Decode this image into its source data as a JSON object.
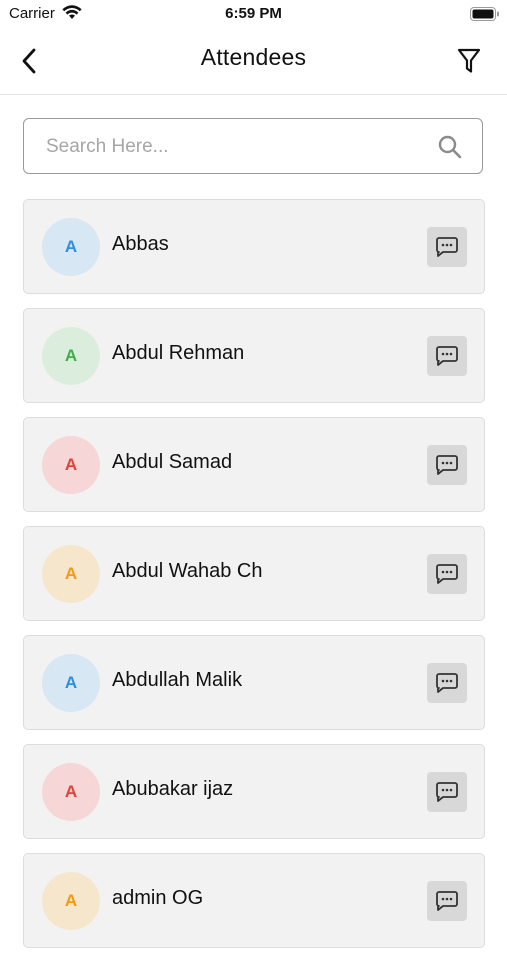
{
  "status_bar": {
    "carrier": "Carrier",
    "time": "6:59 PM"
  },
  "header": {
    "title": "Attendees"
  },
  "search": {
    "placeholder": "Search Here..."
  },
  "attendees": [
    {
      "initial": "A",
      "name": "Abbas",
      "avatar_bg": "#d7e7f4",
      "avatar_fg": "#2e8fe0"
    },
    {
      "initial": "A",
      "name": "Abdul Rehman",
      "avatar_bg": "#dbeedd",
      "avatar_fg": "#3fae4a"
    },
    {
      "initial": "A",
      "name": "Abdul Samad",
      "avatar_bg": "#f6d6d6",
      "avatar_fg": "#e0413a"
    },
    {
      "initial": "A",
      "name": "Abdul Wahab Ch",
      "avatar_bg": "#f6e6cc",
      "avatar_fg": "#f39a12"
    },
    {
      "initial": "A",
      "name": "Abdullah Malik",
      "avatar_bg": "#d7e7f4",
      "avatar_fg": "#2e8fe0"
    },
    {
      "initial": "A",
      "name": "Abubakar ijaz",
      "avatar_bg": "#f6d6d6",
      "avatar_fg": "#e0413a"
    },
    {
      "initial": "A",
      "name": "admin OG",
      "avatar_bg": "#f6e6cc",
      "avatar_fg": "#f39a12"
    }
  ],
  "icons": {
    "back": "chevron-left-icon",
    "filter": "filter-icon",
    "search": "search-icon",
    "chat": "chat-bubble-icon"
  }
}
